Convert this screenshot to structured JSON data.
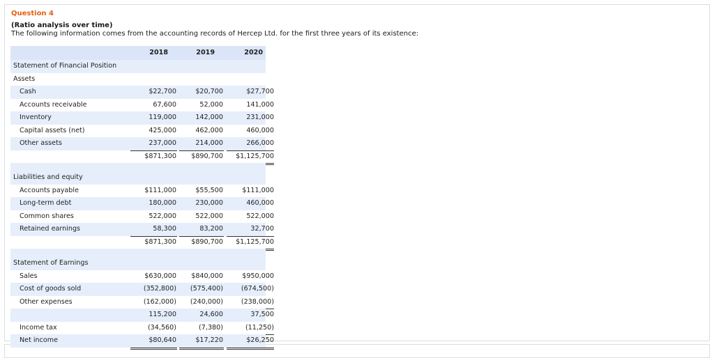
{
  "question": {
    "title": "Question 4",
    "subtitle": "(Ratio analysis over time)",
    "description": "The following information comes from the accounting records of Hercep Ltd. for the first three years of its existence:"
  },
  "table": {
    "years": [
      "2018",
      "2019",
      "2020"
    ],
    "sections": {
      "sfp": "Statement of Financial Position",
      "assets": "Assets",
      "liab": "Liabilities and equity",
      "earnings": "Statement of Earnings"
    },
    "assets": [
      {
        "label": "Cash",
        "values": [
          "$22,700",
          "$20,700",
          "$27,700"
        ]
      },
      {
        "label": "Accounts receivable",
        "values": [
          "67,600",
          "52,000",
          "141,000"
        ]
      },
      {
        "label": "Inventory",
        "values": [
          "119,000",
          "142,000",
          "231,000"
        ]
      },
      {
        "label": "Capital assets (net)",
        "values": [
          "425,000",
          "462,000",
          "460,000"
        ]
      },
      {
        "label": "Other assets",
        "values": [
          "237,000",
          "214,000",
          "266,000"
        ]
      }
    ],
    "assets_total": [
      "$871,300",
      "$890,700",
      "$1,125,700"
    ],
    "liabilities": [
      {
        "label": "Accounts payable",
        "values": [
          "$111,000",
          "$55,500",
          "$111,000"
        ]
      },
      {
        "label": "Long-term debt",
        "values": [
          "180,000",
          "230,000",
          "460,000"
        ]
      },
      {
        "label": "Common shares",
        "values": [
          "522,000",
          "522,000",
          "522,000"
        ]
      },
      {
        "label": "Retained earnings",
        "values": [
          "58,300",
          "83,200",
          "32,700"
        ]
      }
    ],
    "liabilities_total": [
      "$871,300",
      "$890,700",
      "$1,125,700"
    ],
    "earnings": [
      {
        "label": "Sales",
        "values": [
          "$630,000",
          "$840,000",
          "$950,000"
        ]
      },
      {
        "label": "Cost of goods sold",
        "values": [
          "(352,800)",
          "(575,400)",
          "(674,500)"
        ]
      },
      {
        "label": "Other expenses",
        "values": [
          "(162,000)",
          "(240,000)",
          "(238,000)"
        ]
      }
    ],
    "earnings_subtotal": [
      "115,200",
      "24,600",
      "37,500"
    ],
    "income_tax": {
      "label": "Income tax",
      "values": [
        "(34,560)",
        "(7,380)",
        "(11,250)"
      ]
    },
    "net_income": {
      "label": "Net income",
      "values": [
        "$80,640",
        "$17,220",
        "$26,250"
      ]
    }
  }
}
